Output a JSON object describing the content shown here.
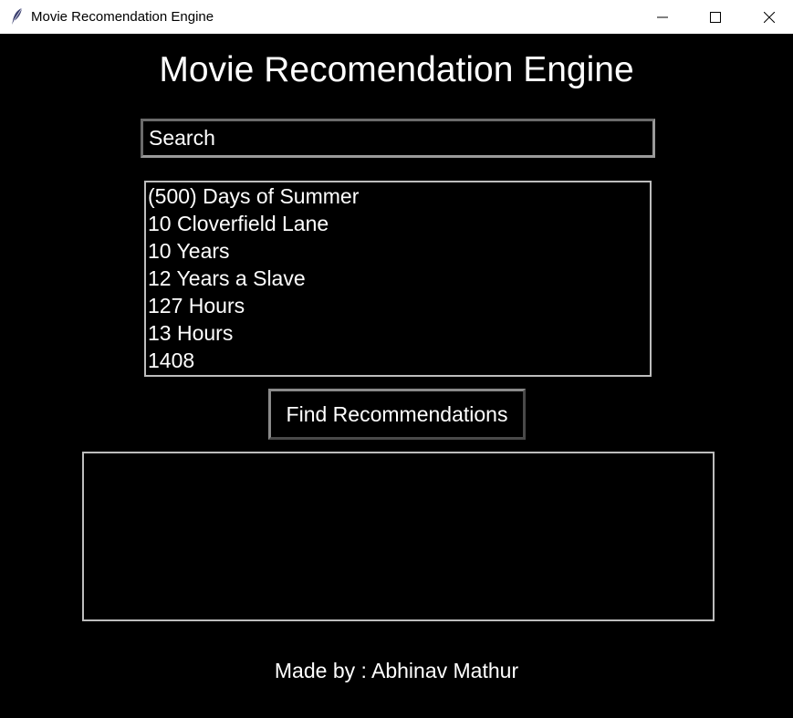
{
  "window": {
    "title": "Movie Recomendation Engine",
    "icon": "feather-icon",
    "controls": [
      "minimize-icon",
      "maximize-icon",
      "close-icon"
    ]
  },
  "app": {
    "heading": "Movie Recomendation Engine",
    "search": {
      "value": "Search"
    },
    "movies": [
      "(500) Days of Summer",
      "10 Cloverfield Lane",
      "10 Years",
      "12 Years a Slave",
      "127 Hours",
      "13 Hours",
      "1408"
    ],
    "find_button": "Find Recommendations",
    "results": [],
    "credit": "Made by : Abhinav Mathur"
  },
  "colors": {
    "background": "#000000",
    "text": "#ffffff",
    "titlebar": "#ffffff",
    "border": "#bdbdbd"
  }
}
